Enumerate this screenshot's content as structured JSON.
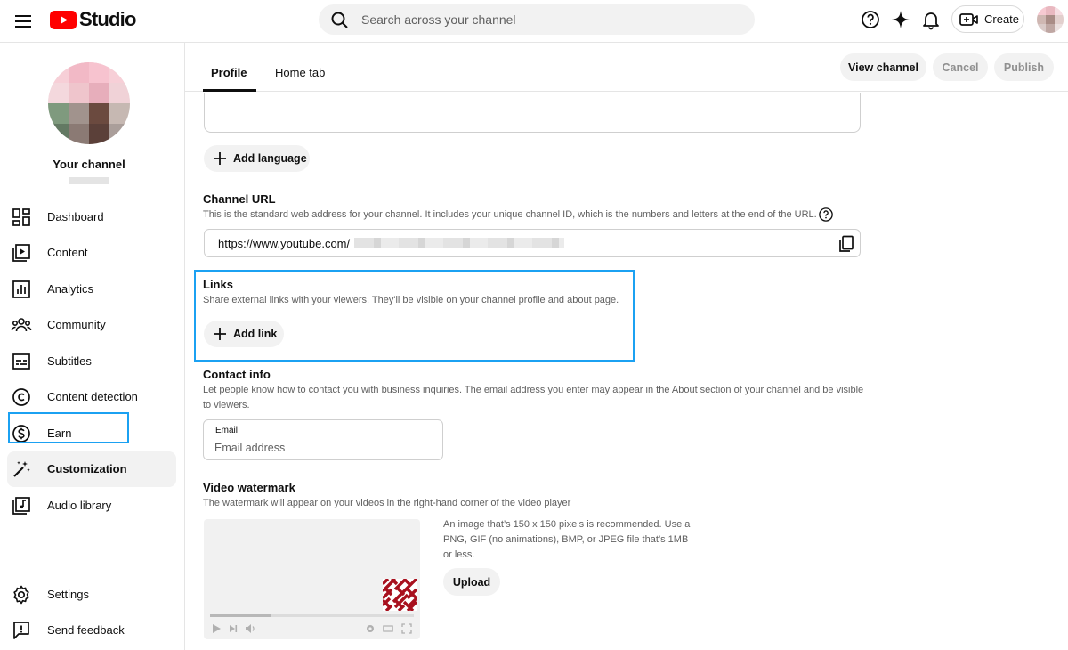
{
  "topbar": {
    "logo_text": "Studio",
    "search_placeholder": "Search across your channel",
    "create_label": "Create",
    "icons": [
      "menu-icon",
      "youtube-logo-icon",
      "search-icon",
      "help-icon",
      "sparkle-icon",
      "bell-icon",
      "create-video-icon"
    ]
  },
  "sidebar": {
    "channel_title": "Your channel",
    "items": [
      {
        "label": "Dashboard",
        "icon": "dashboard-icon"
      },
      {
        "label": "Content",
        "icon": "content-icon"
      },
      {
        "label": "Analytics",
        "icon": "analytics-icon"
      },
      {
        "label": "Community",
        "icon": "community-icon"
      },
      {
        "label": "Subtitles",
        "icon": "subtitles-icon"
      },
      {
        "label": "Content detection",
        "icon": "copyright-icon"
      },
      {
        "label": "Earn",
        "icon": "dollar-icon"
      },
      {
        "label": "Customization",
        "icon": "magic-wand-icon",
        "active": true
      },
      {
        "label": "Audio library",
        "icon": "audio-library-icon"
      }
    ],
    "bottom_items": [
      {
        "label": "Settings",
        "icon": "gear-icon"
      },
      {
        "label": "Send feedback",
        "icon": "feedback-icon"
      }
    ]
  },
  "header": {
    "tabs": [
      {
        "label": "Profile",
        "active": true
      },
      {
        "label": "Home tab"
      }
    ],
    "view_channel": "View channel",
    "cancel": "Cancel",
    "publish": "Publish"
  },
  "content": {
    "add_language": "Add language",
    "channel_url": {
      "title": "Channel URL",
      "description": "This is the standard web address for your channel. It includes your unique channel ID, which is the numbers and letters at the end of the URL.",
      "value": "https://www.youtube.com/"
    },
    "links": {
      "title": "Links",
      "description": "Share external links with your viewers. They'll be visible on your channel profile and about page.",
      "add_link": "Add link"
    },
    "contact": {
      "title": "Contact info",
      "description": "Let people know how to contact you with business inquiries. The email address you enter may appear in the About section of your channel and be visible to viewers.",
      "email_label": "Email",
      "email_placeholder": "Email address"
    },
    "watermark": {
      "title": "Video watermark",
      "description": "The watermark will appear on your videos in the right-hand corner of the video player",
      "info": "An image that’s 150 x 150 pixels is recommended. Use a PNG, GIF (no animations), BMP, or JPEG file that’s 1MB or less.",
      "upload": "Upload"
    }
  },
  "colors": {
    "brand_red": "#ff0000",
    "highlight_outline": "#1ba1f2",
    "watermark_red": "#a8101e"
  }
}
